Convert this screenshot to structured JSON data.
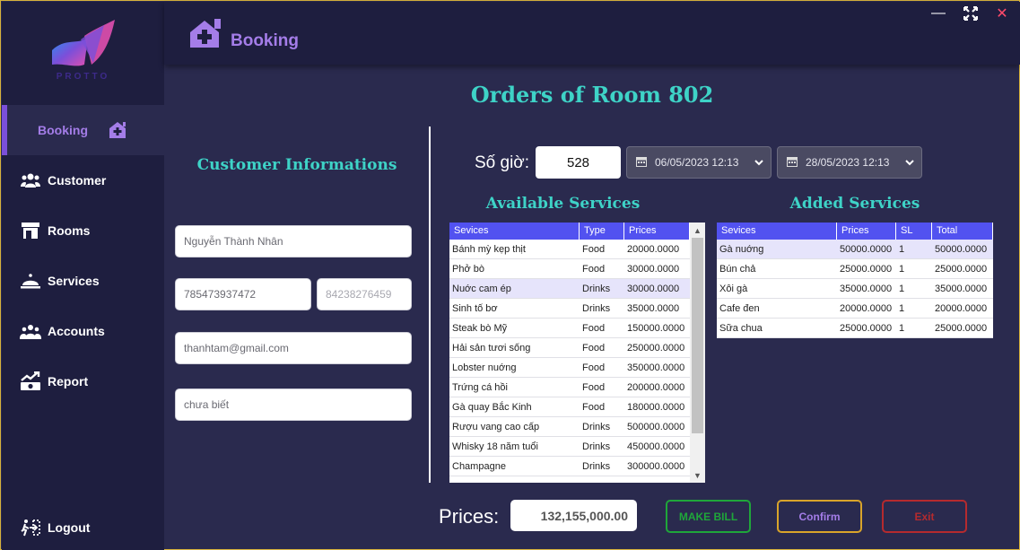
{
  "logo": {
    "text": "PROTTO"
  },
  "sidebar": {
    "items": [
      {
        "label": "Booking",
        "icon": "house-plus-icon"
      },
      {
        "label": "Customer",
        "icon": "people-icon"
      },
      {
        "label": "Rooms",
        "icon": "store-icon"
      },
      {
        "label": "Services",
        "icon": "bell-icon"
      },
      {
        "label": "Accounts",
        "icon": "team-icon"
      },
      {
        "label": "Report",
        "icon": "chart-money-icon"
      }
    ],
    "logout": "Logout"
  },
  "header": {
    "title": "Booking"
  },
  "window_controls": {
    "minimize": "—",
    "maximize": "⤢",
    "close": "✕"
  },
  "main": {
    "title": "Orders of Room 802",
    "customer_title": "Customer Informations",
    "customer": {
      "name": "Nguyễn Thành Nhân",
      "phone": "785473937472",
      "id_number": "84238276459",
      "email": "thanhtam@gmail.com",
      "note": "chưa biết"
    },
    "hours_label": "Số giờ:",
    "hours_value": "528",
    "date_from": "06/05/2023 12:13",
    "date_to": "28/05/2023 12:13",
    "available_title": "Available Services",
    "added_title": "Added Services",
    "available_services": {
      "headers": [
        "Sevices",
        "Type",
        "Prices"
      ],
      "rows": [
        [
          "Bánh mỳ kẹp thịt",
          "Food",
          "20000.0000"
        ],
        [
          "Phở bò",
          "Food",
          "30000.0000"
        ],
        [
          "Nuớc cam ép",
          "Drinks",
          "30000.0000"
        ],
        [
          "Sinh tố bơ",
          "Drinks",
          "35000.0000"
        ],
        [
          "Steak bò Mỹ",
          "Food",
          "150000.0000"
        ],
        [
          "Hải sản tươi sống",
          "Food",
          "250000.0000"
        ],
        [
          "Lobster nuớng",
          "Food",
          "350000.0000"
        ],
        [
          "Trứng cá hồi",
          "Food",
          "200000.0000"
        ],
        [
          "Gà quay Bắc Kinh",
          "Food",
          "180000.0000"
        ],
        [
          "Rượu vang cao cấp",
          "Drinks",
          "500000.0000"
        ],
        [
          "Whisky 18 năm tuổi",
          "Drinks",
          "450000.0000"
        ],
        [
          "Champagne",
          "Drinks",
          "300000.0000"
        ]
      ],
      "selected_index": 2
    },
    "added_services": {
      "headers": [
        "Sevices",
        "Prices",
        "SL",
        "Total"
      ],
      "rows": [
        [
          "Gà nuớng",
          "50000.0000",
          "1",
          "50000.0000"
        ],
        [
          "Bún chả",
          "25000.0000",
          "1",
          "25000.0000"
        ],
        [
          "Xôi gà",
          "35000.0000",
          "1",
          "35000.0000"
        ],
        [
          "Cafe đen",
          "20000.0000",
          "1",
          "20000.0000"
        ],
        [
          "Sữa chua",
          "25000.0000",
          "1",
          "25000.0000"
        ]
      ],
      "selected_index": 0
    },
    "prices_label": "Prices:",
    "prices_value": "132,155,000.00",
    "buttons": {
      "make_bill": "MAKE BILL",
      "confirm": "Confirm",
      "exit": "Exit"
    }
  },
  "colors": {
    "accent_purple": "#a47de8",
    "teal_title": "#3ed3c7",
    "table_header": "#5252f0",
    "make_bill": "#1fa63a",
    "confirm": "#d9a42a",
    "exit": "#b52a2e"
  }
}
